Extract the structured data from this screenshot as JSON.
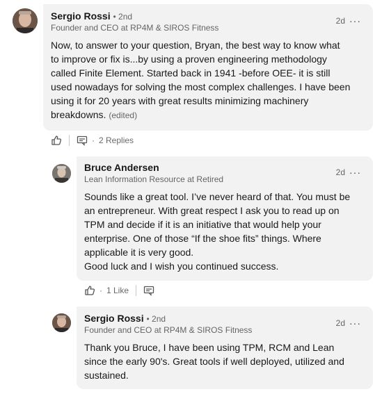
{
  "comments": [
    {
      "author": "Sergio Rossi",
      "degree": "• 2nd",
      "headline": "Founder and CEO at RP4M & SIROS Fitness",
      "time": "2d",
      "lines": [
        "Now, to answer to your question, Bryan, the best way to know what",
        "to improve or fix is...by using a proven engineering methodology",
        "called Finite Element. Started back in 1941 -before OEE- it is still",
        "used nowadays for solving the most complex challenges. I have been",
        "using it for 20 years with great results minimizing machinery",
        "breakdowns."
      ],
      "edited": "(edited)",
      "replies_label": "2 Replies"
    },
    {
      "author": "Bruce Andersen",
      "headline": "Lean Information Resource at Retired",
      "time": "2d",
      "lines": [
        "Sounds like a great tool. I’ve never heard of that. You must be",
        "an entrepreneur. With great respect I ask you to read up on",
        "TPM and decide if it is an initiative that would help your",
        "enterprise. One of those “If the shoe fits” things. Where",
        "applicable it is very good.",
        "Good luck and I wish you continued success."
      ],
      "likes_label": "1 Like"
    },
    {
      "author": "Sergio Rossi",
      "degree": "• 2nd",
      "headline": "Founder and CEO at RP4M & SIROS Fitness",
      "time": "2d",
      "lines": [
        "Thank you Bruce, I have been using TPM, RCM and Lean",
        "since the early 90's. Great tools if well deployed, utilized and",
        "sustained."
      ]
    }
  ],
  "ui": {
    "more_dots": "···",
    "dot_separator": "·"
  },
  "icons": {
    "like": "like-icon",
    "reply": "reply-icon",
    "more": "more-icon"
  },
  "colors": {
    "bubble_bg": "#f2f2f2",
    "text_primary": "#191919",
    "text_secondary": "#666666"
  }
}
